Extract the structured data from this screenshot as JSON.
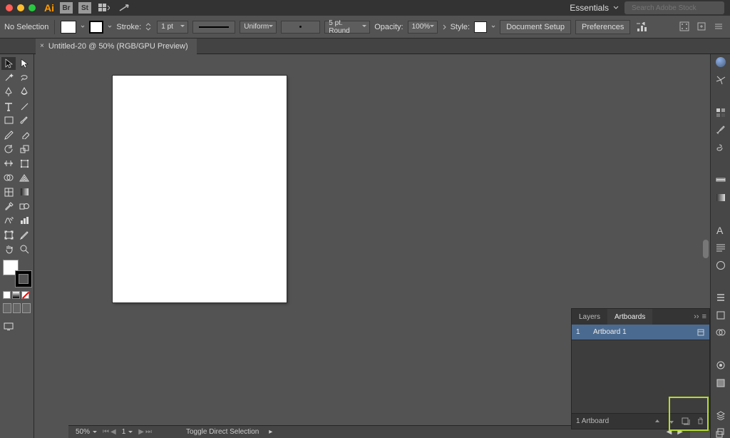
{
  "menubar": {
    "app_logo": "Ai",
    "essentials_label": "Essentials",
    "search_placeholder": "Search Adobe Stock"
  },
  "controlbar": {
    "selection_label": "No Selection",
    "stroke_label": "Stroke:",
    "stroke_weight": "1 pt",
    "stroke_profile": "Uniform",
    "brush_label": "5 pt. Round",
    "opacity_label": "Opacity:",
    "opacity_value": "100%",
    "style_label": "Style:",
    "doc_setup_label": "Document Setup",
    "prefs_label": "Preferences"
  },
  "tab": {
    "title": "Untitled-20 @ 50% (RGB/GPU Preview)"
  },
  "panel": {
    "tab_layers": "Layers",
    "tab_artboards": "Artboards",
    "row_index": "1",
    "row_name": "Artboard 1",
    "footer_count": "1 Artboard"
  },
  "statusbar": {
    "zoom": "50%",
    "page": "1",
    "hint": "Toggle Direct Selection"
  },
  "colors": {
    "highlight": "#b4dc28"
  }
}
